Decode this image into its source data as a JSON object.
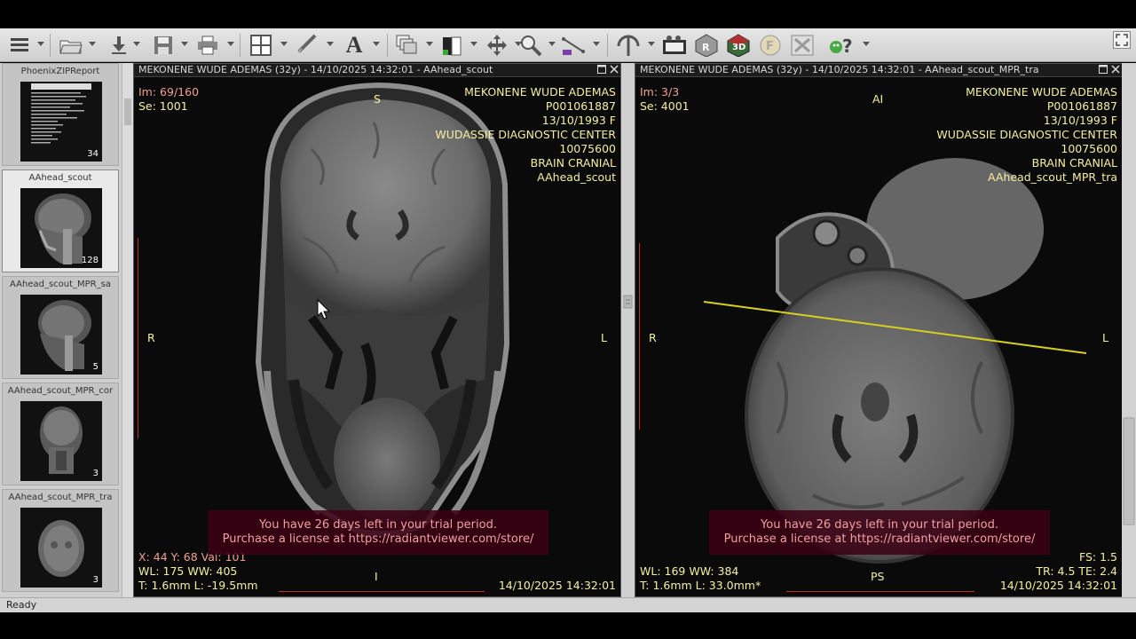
{
  "toolbar": {
    "icons": [
      "menu-icon",
      "open-folder-icon",
      "download-icon",
      "save-icon",
      "print-icon",
      "layout-grid-icon",
      "link-icon",
      "annotation-text-icon",
      "stack-icon",
      "window-level-icon",
      "pan-icon",
      "zoom-icon",
      "measure-icon",
      "cursor-3d-icon",
      "cine-icon",
      "mpr-icon",
      "3d-icon",
      "fusion-icon",
      "tools-icon",
      "help-icon"
    ],
    "text_icon": "A",
    "three_d_label": "3D",
    "fusion_label": "F",
    "help_label": "?"
  },
  "thumbnails": [
    {
      "label": "PhoenixZIPReport",
      "count": "34",
      "selected": false
    },
    {
      "label": "AAhead_scout",
      "count": "128",
      "selected": true
    },
    {
      "label": "AAhead_scout_MPR_sa",
      "count": "5",
      "selected": false
    },
    {
      "label": "AAhead_scout_MPR_cor",
      "count": "3",
      "selected": false
    },
    {
      "label": "AAhead_scout_MPR_tra",
      "count": "3",
      "selected": false
    }
  ],
  "viewports": [
    {
      "title": "MEKONENE WUDE ADEMAS  (32y) - 14/10/2025 14:32:01 - AAhead_scout",
      "image_index": "Im: 69/160",
      "series": "Se: 1001",
      "patient_name": "MEKONENE WUDE ADEMAS",
      "patient_id": "P001061887",
      "dob_sex": "13/10/1993 F",
      "institution": "WUDASSIE DIAGNOSTIC CENTER",
      "accession": "10075600",
      "study": "BRAIN CRANIAL",
      "series_name": "AAhead_scout",
      "orient_top": "S",
      "orient_left": "R",
      "orient_right": "L",
      "orient_bottom": "I",
      "cursor_info": "X: 44 Y: 68 Val: 101",
      "window": "WL: 175 WW: 405",
      "thickness": "T: 1.6mm L: -19.5mm",
      "datetime": "14/10/2025 14:32:01",
      "trial_line1": "You have 26 days left in your trial period.",
      "trial_line2": "Purchase a license at https://radiantviewer.com/store/"
    },
    {
      "title": "MEKONENE WUDE ADEMAS  (32y) - 14/10/2025 14:32:01 - AAhead_scout_MPR_tra",
      "image_index": "Im: 3/3",
      "series": "Se: 4001",
      "patient_name": "MEKONENE WUDE ADEMAS",
      "patient_id": "P001061887",
      "dob_sex": "13/10/1993 F",
      "institution": "WUDASSIE DIAGNOSTIC CENTER",
      "accession": "10075600",
      "study": "BRAIN CRANIAL",
      "series_name": "AAhead_scout_MPR_tra",
      "orient_top": "AI",
      "orient_left": "R",
      "orient_right": "L",
      "orient_bottom": "PS",
      "fs": "FS: 1.5",
      "tr_te": "TR: 4.5  TE: 2.4",
      "window": "WL: 169 WW: 384",
      "thickness": "T: 1.6mm L: 33.0mm*",
      "datetime": "14/10/2025 14:32:01",
      "trial_line1": "You have 26 days left in your trial period.",
      "trial_line2": "Purchase a license at https://radiantviewer.com/store/",
      "reference_line_color": "#d8d020"
    }
  ],
  "status": "Ready"
}
